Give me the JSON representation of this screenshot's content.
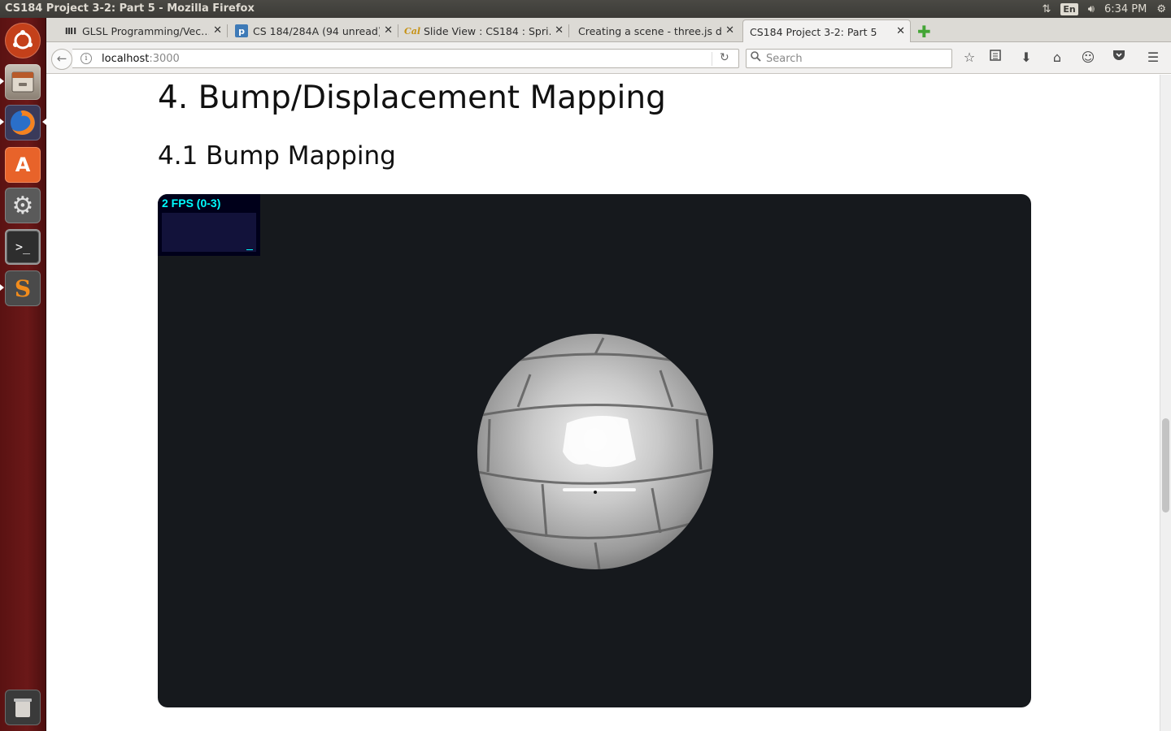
{
  "window": {
    "title": "CS184 Project 3-2: Part 5 - Mozilla Firefox"
  },
  "panel": {
    "lang": "En",
    "time": "6:34 PM"
  },
  "launcher": {
    "items": [
      {
        "name": "ubuntu-dash-icon",
        "glyph": "◎",
        "bg": "#c4401a"
      },
      {
        "name": "files-icon",
        "glyph": "▤",
        "bg": "#8a7f72"
      },
      {
        "name": "firefox-icon",
        "glyph": "●",
        "bg": "#e66000"
      },
      {
        "name": "software-center-icon",
        "glyph": "A",
        "bg": "#e8632a"
      },
      {
        "name": "system-settings-icon",
        "glyph": "⚙",
        "bg": "#6e6e6e"
      },
      {
        "name": "terminal-icon",
        "glyph": ">_",
        "bg": "#2e2e2e"
      },
      {
        "name": "sublime-text-icon",
        "glyph": "S",
        "bg": "#f28c1c"
      },
      {
        "name": "trash-icon",
        "glyph": "🗑",
        "bg": "#a09a93"
      }
    ]
  },
  "tabs": [
    {
      "label": "GLSL Programming/Vec…",
      "favicon": "W"
    },
    {
      "label": "CS 184/284A (94 unread)",
      "favicon": "p"
    },
    {
      "label": "Slide View : CS184 : Spri…",
      "favicon": "Cal"
    },
    {
      "label": "Creating a scene - three.js d…",
      "favicon": ""
    },
    {
      "label": "CS184 Project 3-2: Part 5",
      "favicon": ""
    }
  ],
  "nav": {
    "url_host": "localhost",
    "url_port": ":3000",
    "search_placeholder": "Search"
  },
  "page": {
    "heading": "4. Bump/Displacement Mapping",
    "subheading": "4.1 Bump Mapping",
    "fps": "2 FPS (0-3)"
  },
  "colors": {
    "canvas_bg": "#16191d",
    "fps_text": "#00ffff",
    "launcher": "#6b1818"
  }
}
